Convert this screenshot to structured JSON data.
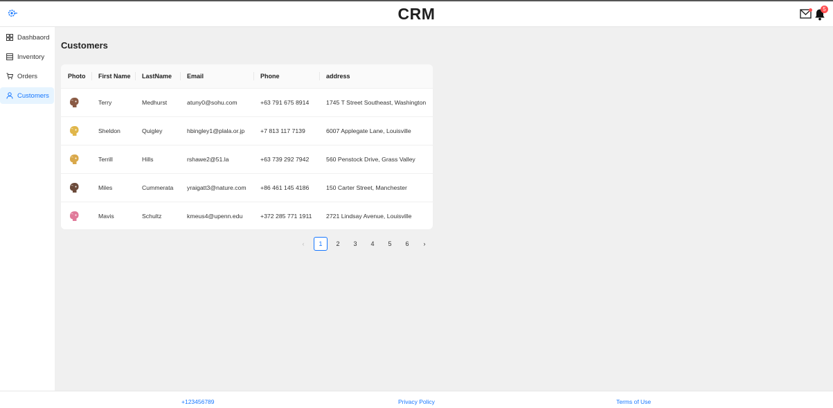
{
  "header": {
    "title": "CRM",
    "logo_icon": "settings-logo-icon",
    "mail_icon": "mail-icon",
    "bell_icon": "bell-icon",
    "notification_count": "5",
    "accent_color": "#1677ff",
    "badge_color": "#ff4d4f"
  },
  "sidebar": {
    "items": [
      {
        "label": "Dashbaord",
        "icon": "dashboard-grid-icon",
        "active": false
      },
      {
        "label": "Inventory",
        "icon": "inventory-icon",
        "active": false
      },
      {
        "label": "Orders",
        "icon": "cart-icon",
        "active": false
      },
      {
        "label": "Customers",
        "icon": "user-icon",
        "active": true
      }
    ]
  },
  "main": {
    "title": "Customers",
    "table": {
      "columns": [
        "Photo",
        "First Name",
        "LastName",
        "Email",
        "Phone",
        "address"
      ],
      "rows": [
        {
          "photo_color": "#8a5a44",
          "first": "Terry",
          "last": "Medhurst",
          "email": "atuny0@sohu.com",
          "phone": "+63 791 675 8914",
          "address": "1745 T Street Southeast, Washington"
        },
        {
          "photo_color": "#e0b64a",
          "first": "Sheldon",
          "last": "Quigley",
          "email": "hbingley1@plala.or.jp",
          "phone": "+7 813 117 7139",
          "address": "6007 Applegate Lane, Louisville"
        },
        {
          "photo_color": "#d9a84a",
          "first": "Terrill",
          "last": "Hills",
          "email": "rshawe2@51.la",
          "phone": "+63 739 292 7942",
          "address": "560 Penstock Drive, Grass Valley"
        },
        {
          "photo_color": "#6b4a3a",
          "first": "Miles",
          "last": "Cummerata",
          "email": "yraigatt3@nature.com",
          "phone": "+86 461 145 4186",
          "address": "150 Carter Street, Manchester"
        },
        {
          "photo_color": "#e07a9a",
          "first": "Mavis",
          "last": "Schultz",
          "email": "kmeus4@upenn.edu",
          "phone": "+372 285 771 1911",
          "address": "2721 Lindsay Avenue, Louisville"
        }
      ]
    },
    "pagination": {
      "prev": "‹",
      "pages": [
        "1",
        "2",
        "3",
        "4",
        "5",
        "6"
      ],
      "current": "1",
      "next": "›"
    }
  },
  "footer": {
    "phone": "+123456789",
    "privacy": "Privacy Policy",
    "terms": "Terms of Use"
  }
}
